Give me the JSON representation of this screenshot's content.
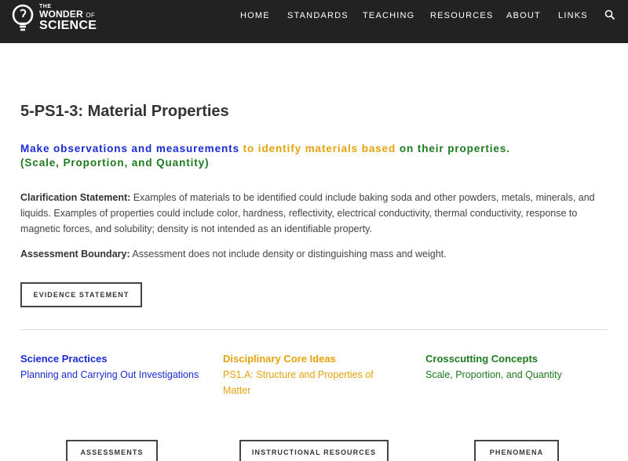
{
  "logo": {
    "the": "THE",
    "wonder": "WONDER",
    "of": "OF",
    "science": "SCIENCE"
  },
  "nav": {
    "items": [
      "HOME",
      "STANDARDS",
      "TEACHING",
      "RESOURCES",
      "ABOUT",
      "LINKS"
    ],
    "search_icon": "search-icon"
  },
  "page": {
    "title": "5-PS1-3: Material Properties"
  },
  "performance_expectation": {
    "part1": "Make observations and measurements ",
    "part2": "to identify materials based ",
    "part3": "on their properties.",
    "part4": "(Scale, Proportion, and Quantity)"
  },
  "clarification": {
    "label": "Clarification Statement:",
    "text": " Examples of materials to be identified could include baking soda and other powders, metals, minerals, and liquids. Examples of properties could include color, hardness, reflectivity, electrical conductivity, thermal conductivity, response to magnetic forces, and solubility; density is not intended as an identifiable property."
  },
  "assessment_boundary": {
    "label": "Assessment Boundary:",
    "text": " Assessment does not include density or distinguishing mass and weight."
  },
  "buttons": {
    "evidence": "EVIDENCE STATEMENT",
    "assessments": "ASSESSMENTS",
    "instructional": "INSTRUCTIONAL RESOURCES",
    "phenomena": "PHENOMENA"
  },
  "columns": {
    "practices": {
      "heading": "Science Practices",
      "link": "Planning and Carrying Out Investigations"
    },
    "core_ideas": {
      "heading": "Disciplinary Core Ideas",
      "link": "PS1.A: Structure and Properties of Matter"
    },
    "crosscutting": {
      "heading": "Crosscutting Concepts",
      "link": "Scale, Proportion, and Quantity"
    }
  },
  "colors": {
    "practices": "#1a2bd1",
    "core_ideas": "#e6a20c",
    "crosscutting": "#1d7a1d",
    "header_bg": "#222222"
  }
}
